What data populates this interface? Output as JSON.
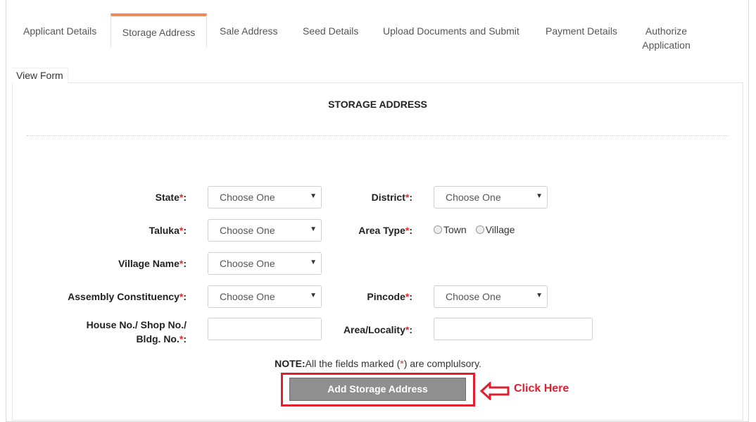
{
  "tabs": [
    {
      "label": "Applicant Details"
    },
    {
      "label": "Storage Address",
      "active": true
    },
    {
      "label": "Sale Address"
    },
    {
      "label": "Seed Details"
    },
    {
      "label": "Upload Documents and Submit"
    },
    {
      "label": "Payment Details"
    },
    {
      "label_line1": "Authorize",
      "label_line2": "Application"
    }
  ],
  "view_form_tab": "View Form",
  "panel_title": "STORAGE ADDRESS",
  "fields": {
    "state": {
      "label": "State",
      "req": "*",
      "colon": ":",
      "value": "Choose One"
    },
    "district": {
      "label": "District",
      "req": "*",
      "colon": ":",
      "value": "Choose One"
    },
    "taluka": {
      "label": "Taluka",
      "req": "*",
      "colon": ":",
      "value": "Choose One"
    },
    "area_type": {
      "label": "Area Type",
      "req": "*",
      "colon": ":",
      "options": [
        "Town",
        "Village"
      ]
    },
    "village_name": {
      "label": "Village Name",
      "req": "*",
      "colon": ":",
      "value": "Choose One"
    },
    "assembly": {
      "label": "Assembly Constituency",
      "req": "*",
      "colon": ":",
      "value": "Choose One"
    },
    "pincode": {
      "label": "Pincode",
      "req": "*",
      "colon": ":",
      "value": "Choose One"
    },
    "house": {
      "label_line1": "House No./ Shop No./",
      "label_line2": "Bldg. No.",
      "req": "*",
      "colon": ":",
      "value": ""
    },
    "area_locality": {
      "label": "Area/Locality",
      "req": "*",
      "colon": ":",
      "value": ""
    }
  },
  "note": {
    "prefix": "NOTE:",
    "text1": "All the fields marked (",
    "star": "*",
    "text2": ") are complulsory."
  },
  "add_button": "Add Storage Address",
  "click_here": "Click Here",
  "colors": {
    "accent_tab": "#f08a5d",
    "required": "#e02b2b",
    "highlight": "#e02030",
    "button": "#8f8f8f"
  },
  "icons": {
    "select_arrow": "caret-down-icon",
    "pointer": "arrow-left-outline-icon"
  }
}
